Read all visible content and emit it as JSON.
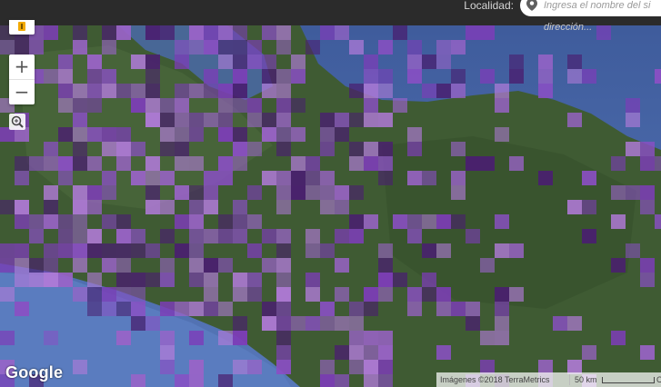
{
  "header": {
    "location_label": "Localidad:",
    "search_placeholder": "Ingresa el nombre del si",
    "search_hint": "dirección..."
  },
  "map_controls": {
    "zoom_in": "+",
    "zoom_out": "−",
    "pegman_icon": "pegman-icon",
    "zoom_box_icon": "zoom-box-icon",
    "pin_icon": "location-pin-icon"
  },
  "footer": {
    "logo": "Google",
    "attribution": "Imágenes ©2018 TerraMetrics",
    "scale_label": "50 km",
    "trailing": "C"
  },
  "colors": {
    "sea": "#4a6aa8",
    "land": "#3e5a32",
    "overlay_light": "#9a63c8",
    "overlay_mid": "#7d3db8",
    "overlay_dark": "#4a1f70"
  }
}
